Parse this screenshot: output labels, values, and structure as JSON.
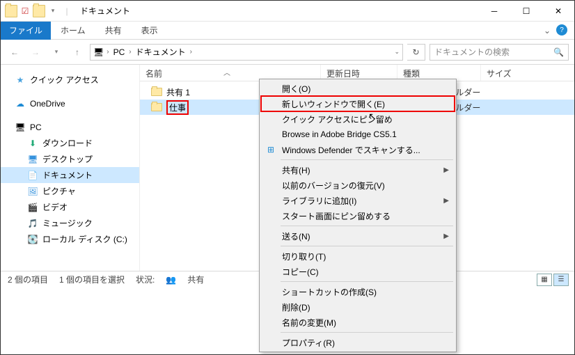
{
  "titlebar": {
    "title": "ドキュメント"
  },
  "ribbon": {
    "file": "ファイル",
    "home": "ホーム",
    "share": "共有",
    "view": "表示"
  },
  "breadcrumb": {
    "pc": "PC",
    "docs": "ドキュメント"
  },
  "search": {
    "placeholder": "ドキュメントの検索"
  },
  "tree": {
    "quick": "クイック アクセス",
    "onedrive": "OneDrive",
    "pc": "PC",
    "downloads": "ダウンロード",
    "desktop": "デスクトップ",
    "docs": "ドキュメント",
    "pictures": "ピクチャ",
    "videos": "ビデオ",
    "music": "ミュージック",
    "cdrive": "ローカル ディスク (C:)"
  },
  "cols": {
    "name": "名前",
    "date": "更新日時",
    "type": "種類",
    "size": "サイズ"
  },
  "rows": [
    {
      "name": "共有 1",
      "type": "ファイル フォルダー"
    },
    {
      "name": "仕事",
      "type": "ファイル フォルダー"
    }
  ],
  "status": {
    "count": "2 個の項目",
    "sel": "1 個の項目を選択",
    "state_label": "状況:",
    "state": "共有"
  },
  "ctx": {
    "open": "開く(O)",
    "open_new": "新しいウィンドウで開く(E)",
    "pin_quick": "クイック アクセスにピン留め",
    "bridge": "Browse in Adobe Bridge CS5.1",
    "defender": "Windows Defender でスキャンする...",
    "share": "共有(H)",
    "restore": "以前のバージョンの復元(V)",
    "library": "ライブラリに追加(I)",
    "pin_start": "スタート画面にピン留めする",
    "send": "送る(N)",
    "cut": "切り取り(T)",
    "copy": "コピー(C)",
    "shortcut": "ショートカットの作成(S)",
    "delete": "削除(D)",
    "rename": "名前の変更(M)",
    "props": "プロパティ(R)"
  }
}
